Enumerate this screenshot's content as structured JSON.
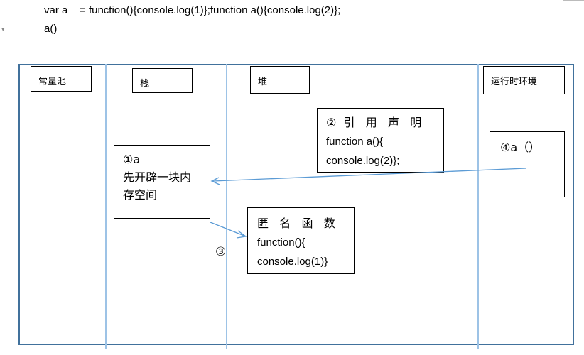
{
  "code_lines": {
    "line1": "var a    = function(){console.log(1)};function a(){console.log(2)};",
    "line2": "a()"
  },
  "regions": {
    "constant_pool": "常量池",
    "stack": "栈",
    "heap": "堆",
    "runtime": "运行时环境"
  },
  "stack_box": {
    "line1": "①a",
    "line2": "先开辟一块内",
    "line3": "存空间"
  },
  "declared_fn_box": {
    "title": "②  引   用   声   明",
    "line1": "function a(){",
    "line2": "console.log(2)};"
  },
  "anon_fn_box": {
    "title": "匿   名   函   数",
    "line1": "function(){",
    "line2": "console.log(1)}"
  },
  "runtime_box": {
    "label": "④a（）"
  },
  "step3_label": "③",
  "colors": {
    "frame": "#41719c",
    "divider": "#9dc3e6",
    "arrow": "#5b9bd5"
  }
}
